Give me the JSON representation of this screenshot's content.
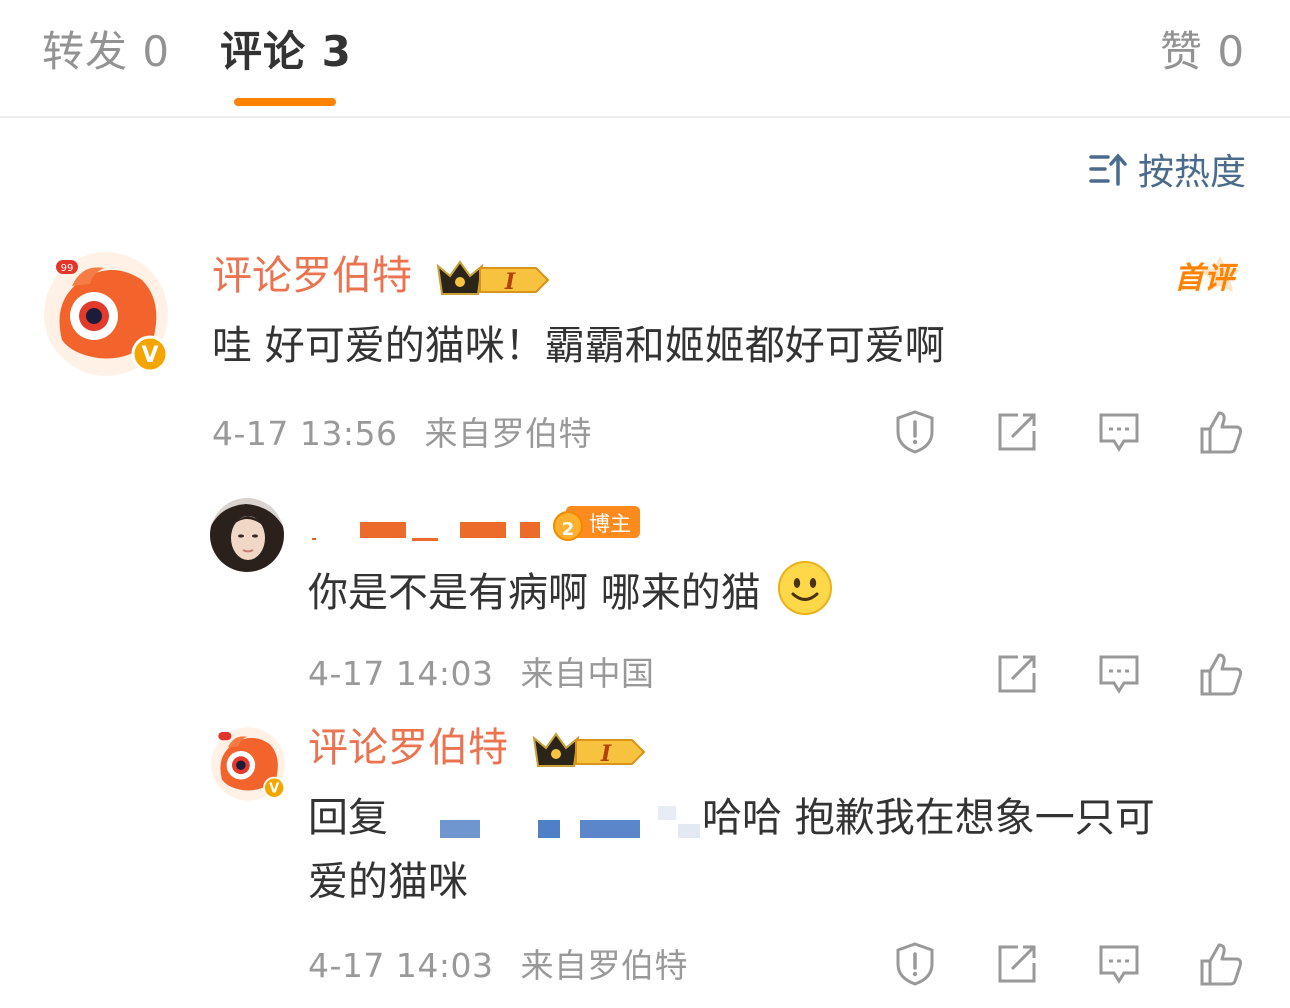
{
  "tabs": {
    "repost": "转发 0",
    "comment": "评论 3",
    "like": "赞 0"
  },
  "sort_label": "按热度",
  "first_comment_tag": "首评",
  "comments": [
    {
      "user": "评论罗伯特",
      "level": "I",
      "text": "哇 好可爱的猫咪！霸霸和姬姬都好可爱啊",
      "time": "4-17 13:56",
      "source": "来自罗伯特"
    },
    {
      "user_badge": "博主",
      "text": "你是不是有病啊 哪来的猫",
      "emoji": "smile-emoji",
      "time": "4-17 14:03",
      "source": "来自中国"
    },
    {
      "user": "评论罗伯特",
      "level": "I",
      "reply_prefix": "回复",
      "text_line1": "哈哈 抱歉我在想象一只可",
      "text_line2": "爱的猫咪",
      "time": "4-17 14:03",
      "source": "来自罗伯特"
    }
  ],
  "colors": {
    "accent": "#ff8200",
    "username": "#eb7350",
    "meta": "#999999",
    "sort": "#4a6b8c"
  }
}
